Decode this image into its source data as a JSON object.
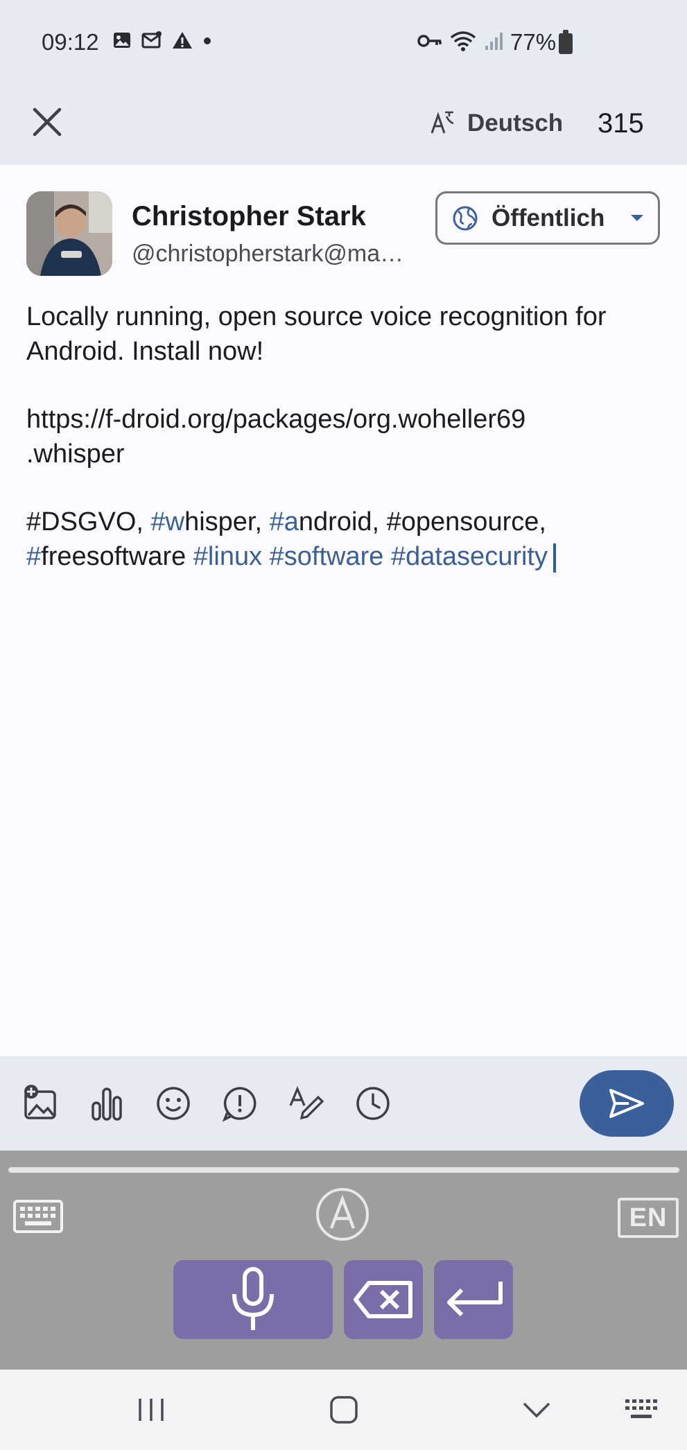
{
  "status_bar": {
    "time": "09:12",
    "battery": "77%",
    "icons_left": [
      "image-icon",
      "mail-icon",
      "warning-icon",
      "dot-icon"
    ],
    "icons_right": [
      "key-icon",
      "wifi-icon",
      "signal-icon",
      "battery-icon"
    ]
  },
  "app_bar": {
    "close_icon": "close-icon",
    "language_label": "Deutsch",
    "language_icon": "translate-icon",
    "char_count": "315"
  },
  "account": {
    "name": "Christopher Stark",
    "handle": "@christopherstark@ma…",
    "visibility_label": "Öffentlich",
    "visibility_icon": "globe-icon"
  },
  "composer": {
    "line1": "Locally running, open source voice recognition for Android. Install now!",
    "url_part1": "https://f-droid.org/packages/org.woheller69",
    "url_part2": ".whisper",
    "tags_line1": {
      "t1": "#DSGVO, ",
      "t2a": "#w",
      "t2b": "hisper, ",
      "t3a": "#a",
      "t3b": "ndroid, ",
      "t4": "#opensource,"
    },
    "tags_line2": {
      "t5a": "#",
      "t5b": "freesoftware ",
      "t6": "#linux",
      "t7": "#software",
      "t8": "#datasecurity"
    }
  },
  "toolbar": {
    "tools": [
      "add-media-icon",
      "poll-icon",
      "emoji-icon",
      "content-warning-icon",
      "formatting-icon",
      "schedule-icon"
    ],
    "send_icon": "send-icon"
  },
  "keyboard": {
    "lang_badge": "EN",
    "auto_badge": "A",
    "icons": [
      "keyboard-icon",
      "auto-icon",
      "language-badge",
      "mic-icon",
      "backspace-icon",
      "enter-icon"
    ]
  },
  "nav_bar": {
    "icons": [
      "recents-icon",
      "home-icon",
      "back-icon",
      "keyboard-switch-icon"
    ]
  },
  "colors": {
    "accent": "#3b5f9a",
    "hashtag": "#3a5f95",
    "surface": "#e6eaf3",
    "keyboard_bg": "#9e9e9e",
    "keyboard_key": "#7a6da8"
  }
}
